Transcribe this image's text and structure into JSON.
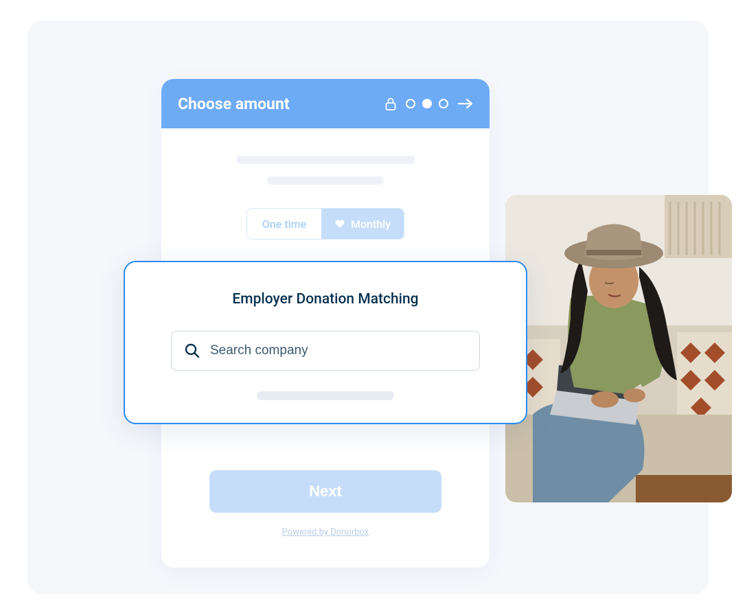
{
  "header": {
    "title": "Choose amount"
  },
  "frequency": {
    "onetime_label": "One time",
    "monthly_label": "Monthly"
  },
  "modal": {
    "title": "Employer Donation Matching",
    "search_placeholder": "Search company"
  },
  "actions": {
    "next_label": "Next"
  },
  "footer": {
    "powered_by": "Powered by Donorbox"
  },
  "colors": {
    "header_bg": "#6eabf7",
    "accent_blue": "#2a8cf2",
    "light_blue": "#c5ddf8",
    "text_dark": "#06304e"
  }
}
